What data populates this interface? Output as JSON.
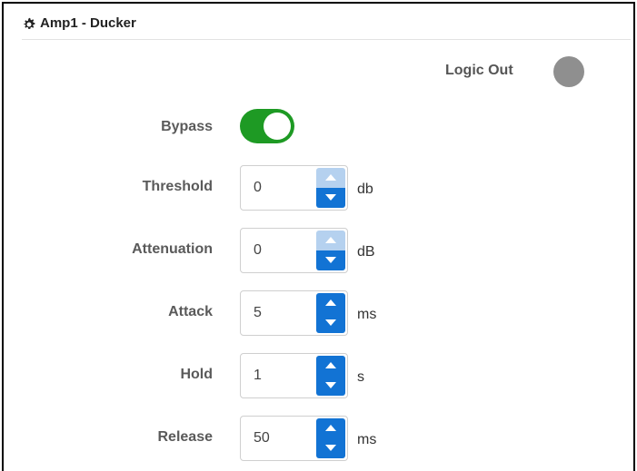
{
  "panel": {
    "title": "Amp1 - Ducker",
    "icon": "gear-icon"
  },
  "logic_out": {
    "label": "Logic Out",
    "state": "off",
    "color": "#8f8f8f"
  },
  "bypass": {
    "label": "Bypass",
    "enabled": true,
    "color": "#1e9a24"
  },
  "fields": [
    {
      "label": "Threshold",
      "value": "0",
      "unit": "db",
      "up_enabled": false,
      "down_enabled": true
    },
    {
      "label": "Attenuation",
      "value": "0",
      "unit": "dB",
      "up_enabled": false,
      "down_enabled": true
    },
    {
      "label": "Attack",
      "value": "5",
      "unit": "ms",
      "up_enabled": true,
      "down_enabled": true
    },
    {
      "label": "Hold",
      "value": "1",
      "unit": "s",
      "up_enabled": true,
      "down_enabled": true
    },
    {
      "label": "Release",
      "value": "50",
      "unit": "ms",
      "up_enabled": true,
      "down_enabled": true
    }
  ],
  "colors": {
    "spinner_active": "#1273d4",
    "spinner_disabled": "#b5d1ef"
  }
}
